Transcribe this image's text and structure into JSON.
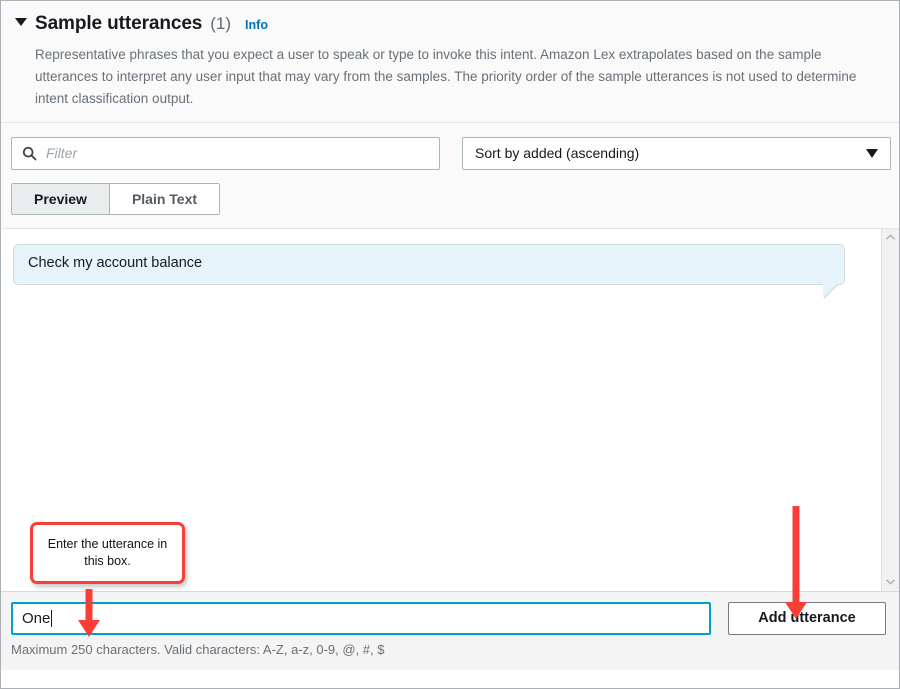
{
  "section": {
    "title": "Sample utterances",
    "count": "(1)",
    "info_label": "Info",
    "caret_icon": "triangle-down-icon",
    "description": "Representative phrases that you expect a user to speak or type to invoke this intent. Amazon Lex extrapolates based on the sample utterances to interpret any user input that may vary from the samples. The priority order of the sample utterances is not used to determine intent classification output."
  },
  "toolbar": {
    "filter": {
      "placeholder": "Filter",
      "value": "",
      "icon": "search-icon"
    },
    "sort": {
      "selected": "Sort by added (ascending)",
      "caret_icon": "triangle-down-icon"
    }
  },
  "tabs": [
    {
      "label": "Preview",
      "active": true
    },
    {
      "label": "Plain Text",
      "active": false
    }
  ],
  "utterances": [
    {
      "text": "Check my account balance"
    }
  ],
  "scrollbar": {
    "up_icon": "chevron-up-icon",
    "down_icon": "chevron-down-icon"
  },
  "footer": {
    "input": {
      "value": "One",
      "placeholder": "",
      "focused": true
    },
    "add_button": "Add utterance",
    "helper_text": "Maximum 250 characters. Valid characters: A-Z, a-z, 0-9, @, #, $"
  },
  "annotations": {
    "callout_text": "Enter the utterance in this box.",
    "arrow_color": "#f73f38",
    "callout_border_color": "#f73f38"
  },
  "colors": {
    "accent_link": "#0073bb",
    "focus_border": "#00a1c9",
    "bubble_bg": "#e7f3fa",
    "panel_bg": "#fafafa",
    "footer_bg": "#f4f4f4"
  }
}
